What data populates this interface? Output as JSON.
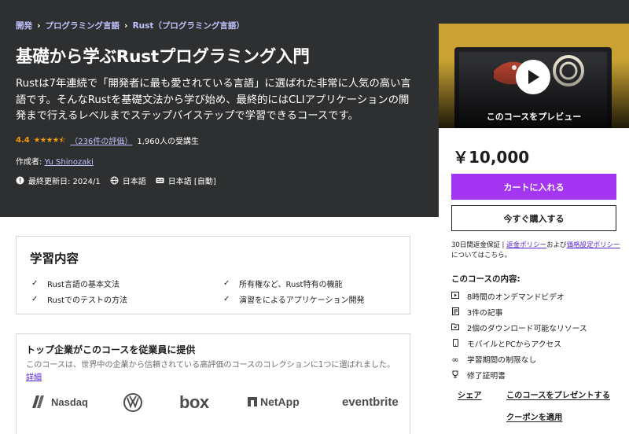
{
  "breadcrumb": [
    "開発",
    "プログラミング言語",
    "Rust（プログラミング言語）"
  ],
  "title": "基礎から学ぶRustプログラミング入門",
  "description": "Rustは7年連続で「開発者に最も愛されている言語」に選ばれた非常に人気の高い言語です。そんなRustを基礎文法から学び始め、最終的にはCLIアプリケーションの開発まで行えるレベルまでステップバイステップで学習できるコースです。",
  "rating": {
    "value": "4.4",
    "stars": 4.5,
    "count_text": "（236件の評価）",
    "students": "1,960人の受講生"
  },
  "creator": {
    "prefix": "作成者:",
    "name": "Yu Shinozaki"
  },
  "meta": {
    "updated": "最終更新日: 2024/1",
    "language": "日本語",
    "captions": "日本語 [自動]"
  },
  "learn": {
    "title": "学習内容",
    "items": [
      "Rust言語の基本文法",
      "所有権など、Rust特有の機能",
      "Rustでのテストの方法",
      "演習をによるアプリケーション開発"
    ]
  },
  "business": {
    "title": "トップ企業がこのコースを従業員に提供",
    "text": "このコースは、世界中の企業から信頼されている高評価のコースのコレクションに1つに選ばれました。",
    "link": "詳細",
    "logos": [
      "Nasdaq",
      "VW",
      "box",
      "NetApp",
      "eventbrite"
    ]
  },
  "sidebar": {
    "preview_label": "このコースをプレビュー",
    "price": "￥10,000",
    "cart_button": "カートに入れる",
    "buy_button": "今すぐ購入する",
    "guarantee_text": "30日間返金保証 | ",
    "refund_link": "返金ポリシー",
    "and": "および",
    "pricing_link": "価格設定ポリシー",
    "suffix": "についてはこちら。",
    "includes_title": "このコースの内容:",
    "includes": [
      "8時間のオンデマンドビデオ",
      "3件の記事",
      "2個のダウンロード可能なリソース",
      "モバイルとPCからアクセス",
      "学習期間の制限なし",
      "修了証明書"
    ],
    "share": "シェア",
    "gift": "このコースをプレゼントする",
    "coupon": "クーポンを適用"
  },
  "colors": {
    "hero_bg": "#2d2f31",
    "accent_purple": "#a435f0",
    "link_purple": "#5624d0",
    "link_light": "#c0c4fc",
    "star": "#f69c08"
  }
}
